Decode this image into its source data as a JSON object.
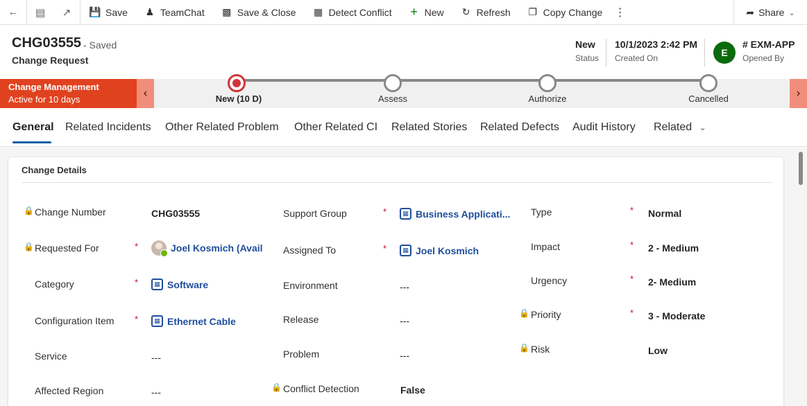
{
  "commandbar": {
    "save": "Save",
    "teamchat": "TeamChat",
    "save_close": "Save & Close",
    "detect_conflict": "Detect Conflict",
    "new": "New",
    "refresh": "Refresh",
    "copy_change": "Copy Change",
    "share": "Share"
  },
  "header": {
    "record_id": "CHG03555",
    "saved_state": "- Saved",
    "entity_type": "Change Request",
    "status_value": "New",
    "status_label": "Status",
    "created_value": "10/1/2023 2:42 PM",
    "created_label": "Created On",
    "owner_initial": "E",
    "owner_value": "# EXM-APP",
    "owner_label": "Opened By"
  },
  "process": {
    "name": "Change Management",
    "status": "Active for 10 days",
    "stages": [
      {
        "label": "New  (10 D)",
        "active": true
      },
      {
        "label": "Assess",
        "active": false
      },
      {
        "label": "Authorize",
        "active": false
      },
      {
        "label": "Cancelled",
        "active": false
      }
    ]
  },
  "tabs": [
    "General",
    "Related Incidents",
    "Other Related Problem",
    "Other Related CI",
    "Related Stories",
    "Related Defects",
    "Audit History",
    "Related"
  ],
  "section": {
    "title": "Change Details",
    "fields": {
      "change_number": {
        "label": "Change Number",
        "value": "CHG03555"
      },
      "requested_for": {
        "label": "Requested For",
        "value": "Joel Kosmich (Avail"
      },
      "category": {
        "label": "Category",
        "value": "Software"
      },
      "configuration_item": {
        "label": "Configuration Item",
        "value": "Ethernet Cable"
      },
      "service": {
        "label": "Service",
        "value": "---"
      },
      "affected_region": {
        "label": "Affected Region",
        "value": "---"
      },
      "support_group": {
        "label": "Support Group",
        "value": "Business Applicati..."
      },
      "assigned_to": {
        "label": "Assigned To",
        "value": "Joel Kosmich"
      },
      "environment": {
        "label": "Environment",
        "value": "---"
      },
      "release": {
        "label": "Release",
        "value": "---"
      },
      "problem": {
        "label": "Problem",
        "value": "---"
      },
      "conflict_detection": {
        "label": "Conflict Detection",
        "value": "False"
      },
      "type": {
        "label": "Type",
        "value": "Normal"
      },
      "impact": {
        "label": "Impact",
        "value": "2 - Medium"
      },
      "urgency": {
        "label": "Urgency",
        "value": "2- Medium"
      },
      "priority": {
        "label": "Priority",
        "value": "3 - Moderate"
      },
      "risk": {
        "label": "Risk",
        "value": "Low"
      }
    },
    "required_marker": "*"
  },
  "colors": {
    "stage_active": "#d13438",
    "process_bar": "#e0421f",
    "link": "#1f4e9c",
    "owner_avatar": "#0b6a0b"
  }
}
